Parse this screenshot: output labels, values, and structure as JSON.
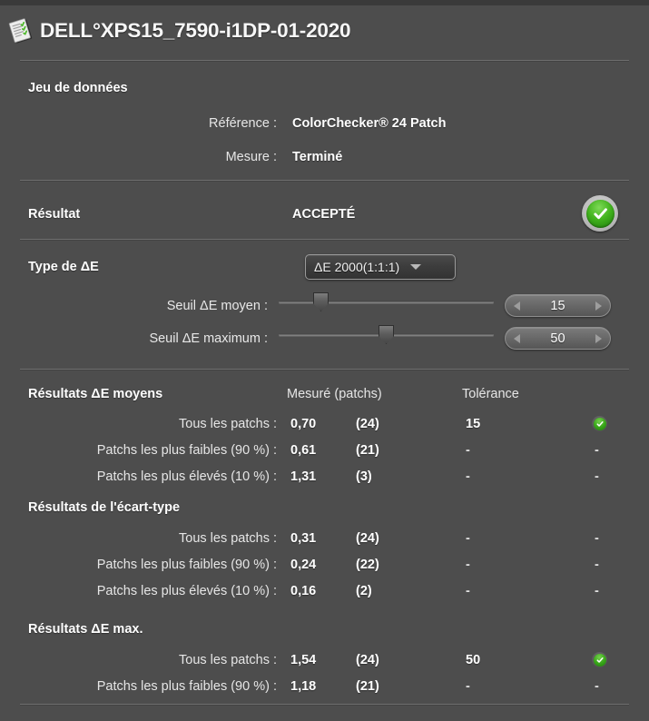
{
  "window": {
    "title": "DELL°XPS15_7590-i1DP-01-2020",
    "title_icon": "document-report-icon"
  },
  "dataset": {
    "heading": "Jeu de données",
    "reference_label": "Référence :",
    "reference_value": "ColorChecker® 24 Patch",
    "measure_label": "Mesure :",
    "measure_value": "Terminé"
  },
  "result": {
    "label": "Résultat",
    "value": "ACCEPTÉ",
    "status_icon": "green-check-badge-icon"
  },
  "delta_e": {
    "type_label": "Type de ΔE",
    "type_value": "ΔE 2000(1:1:1)",
    "dropdown_icon": "chevron-down-icon",
    "mean_threshold_label": "Seuil ΔE moyen :",
    "mean_threshold_value": "15",
    "max_threshold_label": "Seuil ΔE maximum :",
    "max_threshold_value": "50",
    "spinner_left_icon": "triangle-left-icon",
    "spinner_right_icon": "triangle-right-icon"
  },
  "table": {
    "col_measured": "Mesuré (patchs)",
    "col_tolerance": "Tolérance",
    "sections": [
      {
        "heading": "Résultats ΔE moyens",
        "rows": [
          {
            "label": "Tous les patchs :",
            "measured": "0,70",
            "count": "(24)",
            "tolerance": "15",
            "status": "pass"
          },
          {
            "label": "Patchs les plus faibles (90 %) :",
            "measured": "0,61",
            "count": "(21)",
            "tolerance": "-",
            "status": "none"
          },
          {
            "label": "Patchs les plus élevés (10 %) :",
            "measured": "1,31",
            "count": "(3)",
            "tolerance": "-",
            "status": "none"
          }
        ]
      },
      {
        "heading": "Résultats de l'écart-type",
        "rows": [
          {
            "label": "Tous les patchs :",
            "measured": "0,31",
            "count": "(24)",
            "tolerance": "-",
            "status": "none"
          },
          {
            "label": "Patchs les plus faibles (90 %) :",
            "measured": "0,24",
            "count": "(22)",
            "tolerance": "-",
            "status": "none"
          },
          {
            "label": "Patchs les plus élevés (10 %) :",
            "measured": "0,16",
            "count": "(2)",
            "tolerance": "-",
            "status": "none"
          }
        ]
      },
      {
        "heading": "Résultats ΔE max.",
        "rows": [
          {
            "label": "Tous les patchs :",
            "measured": "1,54",
            "count": "(24)",
            "tolerance": "50",
            "status": "pass"
          },
          {
            "label": "Patchs les plus faibles (90 %) :",
            "measured": "1,18",
            "count": "(21)",
            "tolerance": "-",
            "status": "none"
          }
        ]
      }
    ]
  },
  "colors": {
    "background": "#4d4d4d",
    "separator": "#6e6e6e",
    "text": "#f2f2f2",
    "accent_green": "#3aa81a"
  }
}
